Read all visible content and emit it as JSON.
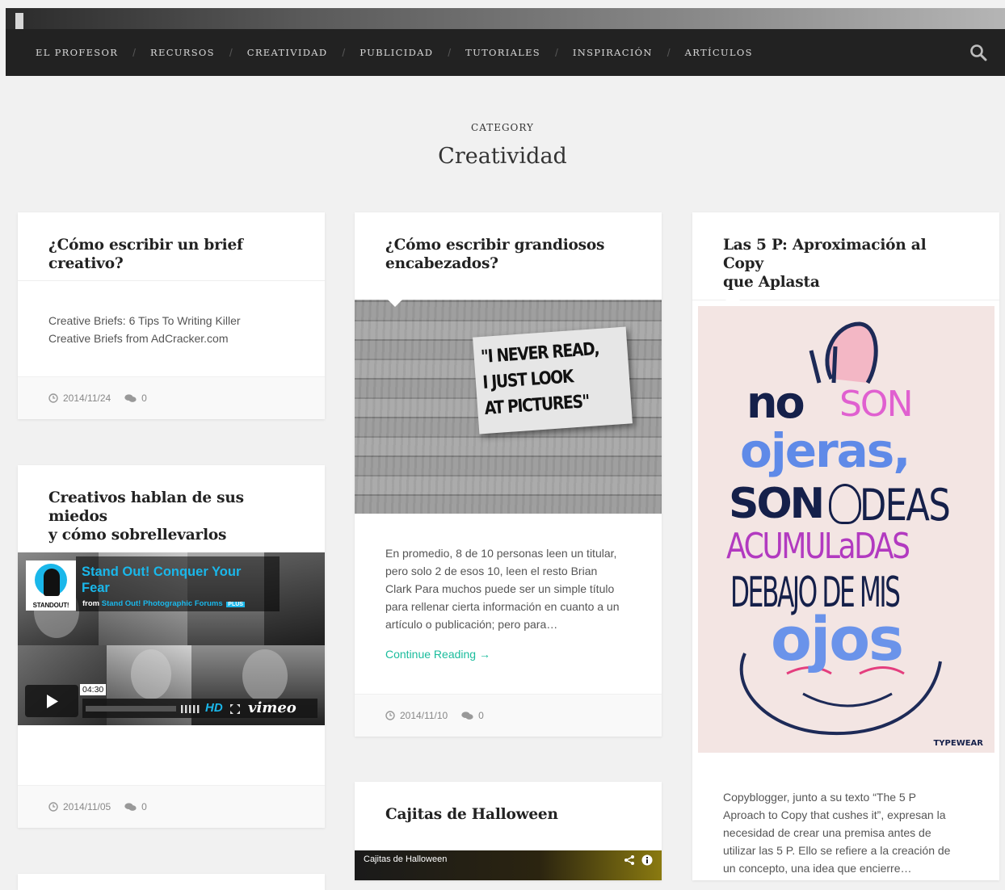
{
  "nav": {
    "items": [
      "EL PROFESOR",
      "RECURSOS",
      "CREATIVIDAD",
      "PUBLICIDAD",
      "TUTORIALES",
      "INSPIRACIÓN",
      "ARTÍCULOS"
    ],
    "separator": "/",
    "search_icon": "search-icon"
  },
  "category": {
    "label": "CATEGORY",
    "title": "Creatividad"
  },
  "posts": {
    "brief": {
      "title": "¿Cómo escribir un brief creativo?",
      "excerpt_line1": "Creative Briefs: 6 Tips To Writing Killer",
      "excerpt_line2": "Creative Briefs from AdCracker.com",
      "date": "2014/11/24",
      "comments": "0"
    },
    "miedos": {
      "title_line1": "Creativos hablan de sus miedos",
      "title_line2": "y cómo sobrellevarlos",
      "video": {
        "title_line1": "Stand Out! Conquer Your",
        "title_line2": "Fear",
        "from_prefix": "from",
        "from_source": "Stand Out! Photographic Forums",
        "plus_badge": "PLUS",
        "logo_text": "STANDOUT!",
        "time": "04:30",
        "hd": "HD",
        "brand": "vimeo"
      },
      "date": "2014/11/05",
      "comments": "0"
    },
    "encabezados": {
      "title_line1": "¿Cómo escribir grandiosos",
      "title_line2": "encabezados?",
      "image_text_line1": "\"I NEVER READ,",
      "image_text_line2": "I JUST LOOK",
      "image_text_line3": "AT PICTURES\"",
      "excerpt": [
        "En promedio, 8 de 10 personas leen un titular,",
        "pero solo 2 de esos 10, leen el resto Brian",
        "Clark Para muchos puede ser un simple título",
        "para rellenar cierta información en cuanto a un",
        "artículo o publicación; pero para…"
      ],
      "continue": "Continue Reading →",
      "date": "2014/11/10",
      "comments": "0"
    },
    "halloween": {
      "title": "Cajitas de Halloween",
      "video_title": "Cajitas de Halloween"
    },
    "copy": {
      "title_line1": "Las 5 P: Aproximación al Copy",
      "title_line2": "que Aplasta",
      "image_words": [
        "no",
        "SON",
        "ojeras,",
        "SON",
        "DEAS",
        "ACUMULaDAS",
        "DEBAJO DE MIS",
        "ojos"
      ],
      "image_brand": "TYPEWEAR",
      "excerpt": [
        "Copyblogger, junto a su texto “The 5 P",
        "Aproach to Copy that cushes it”, expresan la",
        "necesidad de crear una premisa antes de",
        "utilizar las 5 P. Ello se refiere a la creación de",
        "un concepto, una idea que encierre…"
      ]
    }
  },
  "colors": {
    "nav_bg": "#222222",
    "page_bg": "#f1f1f1",
    "accent": "#1abc9c",
    "vimeo_blue": "#1ab7ea"
  }
}
